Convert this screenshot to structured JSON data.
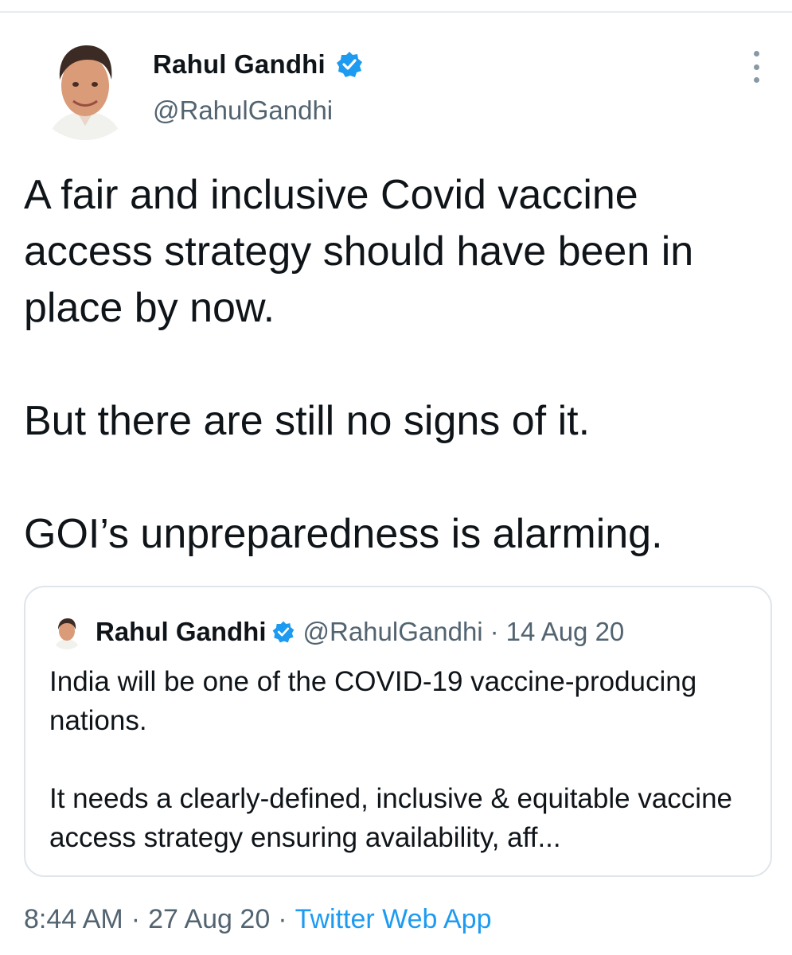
{
  "tweet": {
    "author_name": "Rahul Gandhi",
    "author_handle": "@RahulGandhi",
    "verified_icon": "verified-badge-icon",
    "more_icon": "more-vertical-icon",
    "paragraphs": [
      "A fair and inclusive Covid vaccine access strategy should have been in place by now.",
      "But there are still no signs of it.",
      "GOI’s unpreparedness is alarming."
    ],
    "time": "8:44 AM",
    "date": "27 Aug 20",
    "separator": "·",
    "source": "Twitter Web App"
  },
  "quoted_tweet": {
    "author_name": "Rahul Gandhi",
    "author_handle": "@RahulGandhi",
    "separator": "·",
    "date": "14 Aug 20",
    "paragraphs": [
      "India will be one of the COVID-19 vaccine-producing nations.",
      "It needs a clearly-defined, inclusive & equitable vaccine access strategy ensuring availability, aff..."
    ]
  },
  "colors": {
    "accent": "#1d9bf0",
    "text": "#0f1419",
    "muted": "#536471",
    "border": "#dfe5ea"
  }
}
